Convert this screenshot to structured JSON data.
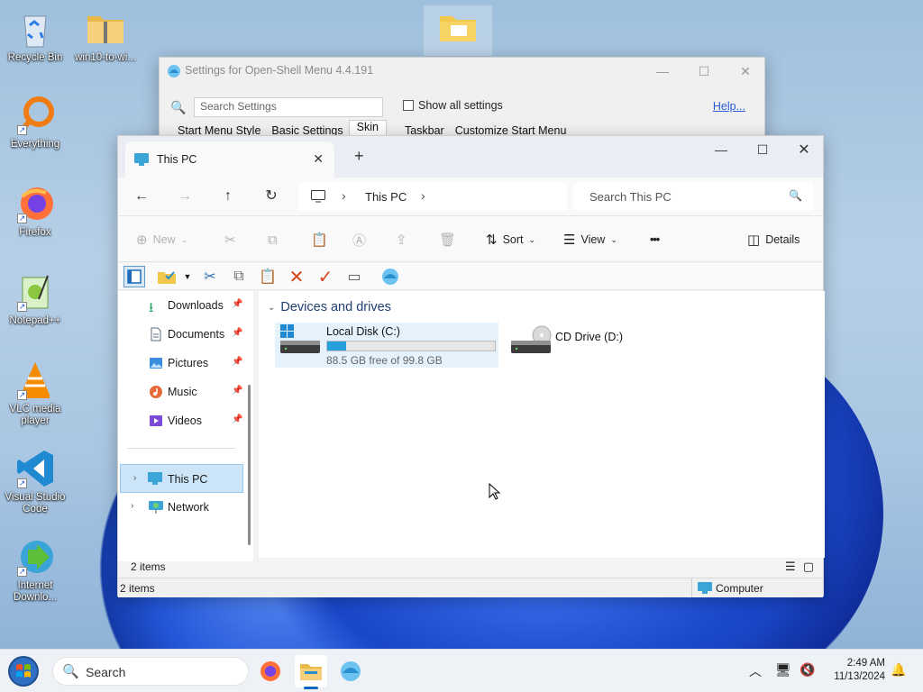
{
  "desktop": {
    "icons": [
      {
        "label": "Recycle Bin",
        "icon": "recycle-bin-icon"
      },
      {
        "label": "win10-to-wi...",
        "icon": "zip-folder-icon"
      },
      {
        "label": "Everything",
        "icon": "everything-icon"
      },
      {
        "label": "Firefox",
        "icon": "firefox-icon"
      },
      {
        "label": "Notepad++",
        "icon": "notepadpp-icon"
      },
      {
        "label": "VLC media player",
        "icon": "vlc-icon"
      },
      {
        "label": "Visual Studio Code",
        "icon": "vscode-icon"
      },
      {
        "label": "Internet Downlo...",
        "icon": "idm-icon"
      }
    ]
  },
  "settings_window": {
    "title": "Settings for Open-Shell Menu 4.4.191",
    "search_placeholder": "Search Settings",
    "show_all_label": "Show all settings",
    "help_label": "Help...",
    "tabs": [
      "Start Menu Style",
      "Basic Settings",
      "Skin",
      "Taskbar",
      "Customize Start Menu"
    ],
    "active_tab": "Skin"
  },
  "explorer": {
    "tab_title": "This PC",
    "new_tab": "+",
    "breadcrumb": "This PC",
    "search_placeholder": "Search This PC",
    "commands": {
      "new": "New",
      "sort": "Sort",
      "view": "View",
      "more": "•••",
      "details": "Details"
    },
    "nav": {
      "quick_access": [
        {
          "label": "Downloads",
          "icon": "download-icon"
        },
        {
          "label": "Documents",
          "icon": "documents-icon"
        },
        {
          "label": "Pictures",
          "icon": "pictures-icon"
        },
        {
          "label": "Music",
          "icon": "music-icon"
        },
        {
          "label": "Videos",
          "icon": "videos-icon"
        }
      ],
      "this_pc": "This PC",
      "network": "Network"
    },
    "group_header": "Devices and drives",
    "drives": [
      {
        "name": "Local Disk (C:)",
        "info": "88.5 GB free of 99.8 GB",
        "used_fraction": 0.113
      },
      {
        "name": "CD Drive (D:)"
      }
    ],
    "item_count": "2 items",
    "statusbar": {
      "left": "2 items",
      "right": "Computer"
    }
  },
  "taskbar": {
    "search_label": "Search",
    "time": "2:49 AM",
    "date": "11/13/2024"
  },
  "colors": {
    "accent": "#0067c0",
    "drive_bar": "#26a0da",
    "selection": "#cce4f7"
  }
}
